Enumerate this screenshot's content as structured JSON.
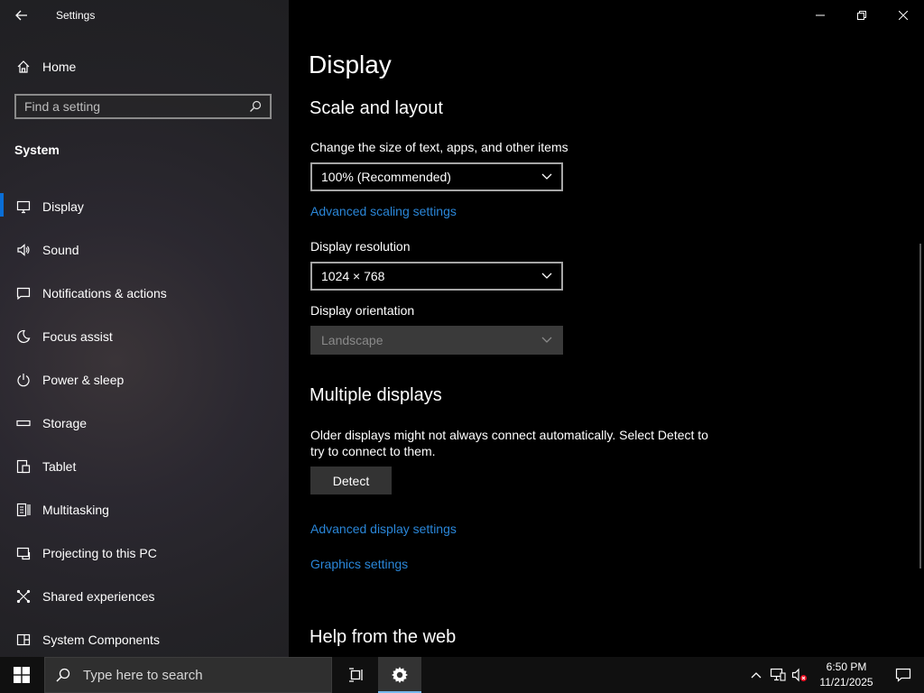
{
  "window": {
    "title": "Settings"
  },
  "sidebar": {
    "home_label": "Home",
    "search_placeholder": "Find a setting",
    "section": "System",
    "items": [
      {
        "label": "Display",
        "icon": "monitor-icon",
        "active": true
      },
      {
        "label": "Sound",
        "icon": "speaker-icon"
      },
      {
        "label": "Notifications & actions",
        "icon": "message-icon"
      },
      {
        "label": "Focus assist",
        "icon": "moon-icon"
      },
      {
        "label": "Power & sleep",
        "icon": "power-icon"
      },
      {
        "label": "Storage",
        "icon": "storage-icon"
      },
      {
        "label": "Tablet",
        "icon": "tablet-icon"
      },
      {
        "label": "Multitasking",
        "icon": "multitasking-icon"
      },
      {
        "label": "Projecting to this PC",
        "icon": "projecting-icon"
      },
      {
        "label": "Shared experiences",
        "icon": "shared-icon"
      },
      {
        "label": "System Components",
        "icon": "components-icon"
      }
    ]
  },
  "main": {
    "title": "Display",
    "scale_layout": {
      "heading": "Scale and layout",
      "scale_label": "Change the size of text, apps, and other items",
      "scale_value": "100% (Recommended)",
      "advanced_scaling_link": "Advanced scaling settings",
      "resolution_label": "Display resolution",
      "resolution_value": "1024 × 768",
      "orientation_label": "Display orientation",
      "orientation_value": "Landscape"
    },
    "multiple_displays": {
      "heading": "Multiple displays",
      "description": "Older displays might not always connect automatically. Select Detect to try to connect to them.",
      "detect_button": "Detect",
      "advanced_display_link": "Advanced display settings",
      "graphics_link": "Graphics settings"
    },
    "help": {
      "heading": "Help from the web"
    }
  },
  "taskbar": {
    "search_placeholder": "Type here to search",
    "time": "6:50 PM",
    "date": "11/21/2025"
  },
  "colors": {
    "accent": "#0a6ed6",
    "link": "#2a86d8",
    "background": "#000000"
  }
}
